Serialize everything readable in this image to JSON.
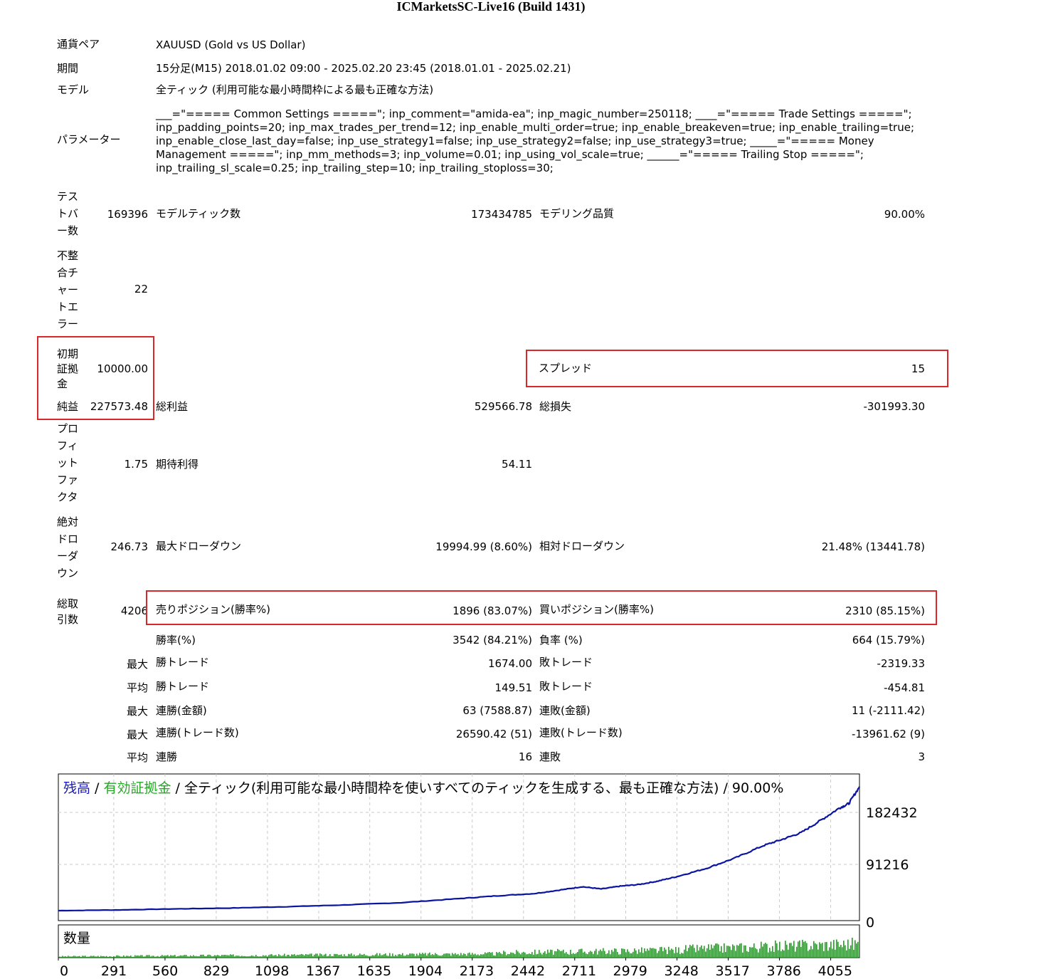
{
  "report": {
    "title": "ICMarketsSC-Live16 (Build 1431)"
  },
  "info": {
    "pair_label": "通貨ペア",
    "pair_value": "XAUUSD (Gold vs US Dollar)",
    "period_label": "期間",
    "period_value": "15分足(M15) 2018.01.02 09:00 - 2025.02.20 23:45 (2018.01.01 - 2025.02.21)",
    "model_label": "モデル",
    "model_value": "全ティック (利用可能な最小時間枠による最も正確な方法)",
    "params_label": "パラメーター",
    "params_value": "___=\"===== Common Settings =====\"; inp_comment=\"amida-ea\"; inp_magic_number=250118; ____=\"===== Trade Settings =====\"; inp_padding_points=20; inp_max_trades_per_trend=12; inp_enable_multi_order=true; inp_enable_breakeven=true; inp_enable_trailing=true; inp_enable_close_last_day=false; inp_use_strategy1=false; inp_use_strategy2=false; inp_use_strategy3=true; _____=\"===== Money Management =====\"; inp_mm_methods=3; inp_volume=0.01; inp_using_vol_scale=true; ______=\"===== Trailing Stop =====\"; inp_trailing_sl_scale=0.25; inp_trailing_step=10; inp_trailing_stoploss=30;"
  },
  "stats": {
    "test_bars_label": "テストバー数",
    "test_bars_value": "169396",
    "model_ticks_label": "モデルティック数",
    "model_ticks_value": "173434785",
    "model_quality_label": "モデリング品質",
    "model_quality_value": "90.00%",
    "mismatch_label": "不整合チャートエラー",
    "mismatch_value": "22",
    "initial_deposit_label": "初期証拠金",
    "initial_deposit_value": "10000.00",
    "spread_label": "スプレッド",
    "spread_value": "15",
    "net_profit_label": "純益",
    "net_profit_value": "227573.48",
    "gross_profit_label": "総利益",
    "gross_profit_value": "529566.78",
    "gross_loss_label": "総損失",
    "gross_loss_value": "-301993.30",
    "profit_factor_label": "プロフィットファクタ",
    "profit_factor_value": "1.75",
    "expected_payoff_label": "期待利得",
    "expected_payoff_value": "54.11",
    "abs_dd_label": "絶対ドローダウン",
    "abs_dd_value": "246.73",
    "max_dd_label": "最大ドローダウン",
    "max_dd_value": "19994.99 (8.60%)",
    "rel_dd_label": "相対ドローダウン",
    "rel_dd_value": "21.48% (13441.78)",
    "total_trades_label": "総取引数",
    "total_trades_value": "4206",
    "short_label": "売りポジション(勝率%)",
    "short_value": "1896 (83.07%)",
    "long_label": "買いポジション(勝率%)",
    "long_value": "2310 (85.15%)",
    "win_rate_label": "勝率(%)",
    "win_rate_value": "3542 (84.21%)",
    "loss_rate_label": "負率 (%)",
    "loss_rate_value": "664 (15.79%)",
    "max_label": "最大",
    "avg_label": "平均",
    "largest_win_label": "勝トレード",
    "largest_win_value": "1674.00",
    "largest_loss_label": "敗トレード",
    "largest_loss_value": "-2319.33",
    "avg_win_label": "勝トレード",
    "avg_win_value": "149.51",
    "avg_loss_label": "敗トレード",
    "avg_loss_value": "-454.81",
    "max_consec_wins_amt_label": "連勝(金額)",
    "max_consec_wins_amt_value": "63 (7588.87)",
    "max_consec_losses_amt_label": "連敗(金額)",
    "max_consec_losses_amt_value": "11 (-2111.42)",
    "max_consec_wins_cnt_label": "連勝(トレード数)",
    "max_consec_wins_cnt_value": "26590.42 (51)",
    "max_consec_losses_cnt_label": "連敗(トレード数)",
    "max_consec_losses_cnt_value": "-13961.62 (9)",
    "avg_consec_wins_label": "連勝",
    "avg_consec_wins_value": "16",
    "avg_consec_losses_label": "連敗",
    "avg_consec_losses_value": "3"
  },
  "chart_data": {
    "type": "line",
    "legend_balance": "残高",
    "legend_sep1": " / ",
    "legend_equity": "有効証拠金",
    "legend_rest": " / 全ティック(利用可能な最小時間枠を使いすべてのティックを生成する、最も正確な方法) / 90.00%",
    "volume_label": "数量",
    "colors": {
      "balance": "#0a14a0",
      "equity": "#00aa00",
      "volume": "#11aa11",
      "legend_balance": "#1a1ab0",
      "legend_equity": "#22aa22",
      "grid": "#c8c8c8"
    },
    "y_ticks": [
      "182432",
      "91216",
      "0"
    ],
    "y_tick_values": [
      182432,
      91216,
      0
    ],
    "ylim": [
      0,
      250000
    ],
    "x_ticks": [
      "0",
      "291",
      "560",
      "829",
      "1098",
      "1367",
      "1635",
      "1904",
      "2173",
      "2442",
      "2711",
      "2979",
      "3248",
      "3517",
      "3786",
      "4055"
    ],
    "x_tick_values": [
      0,
      291,
      560,
      829,
      1098,
      1367,
      1635,
      1904,
      2173,
      2442,
      2711,
      2979,
      3248,
      3517,
      3786,
      4055
    ],
    "xlim": [
      0,
      4206
    ],
    "series": [
      {
        "x": [
          0,
          300,
          600,
          900,
          1200,
          1500,
          1800,
          2100,
          2300,
          2500,
          2650,
          2750,
          2850,
          2950,
          3050,
          3150,
          3250,
          3400,
          3550,
          3700,
          3800,
          3900,
          4000,
          4100,
          4150,
          4206
        ],
        "values": [
          10000,
          11200,
          13000,
          14500,
          17000,
          20000,
          24000,
          31000,
          36000,
          40000,
          47000,
          52000,
          48000,
          53000,
          56000,
          62000,
          70000,
          84000,
          102000,
          124000,
          135000,
          147000,
          168000,
          190000,
          198000,
          227573
        ]
      }
    ]
  }
}
